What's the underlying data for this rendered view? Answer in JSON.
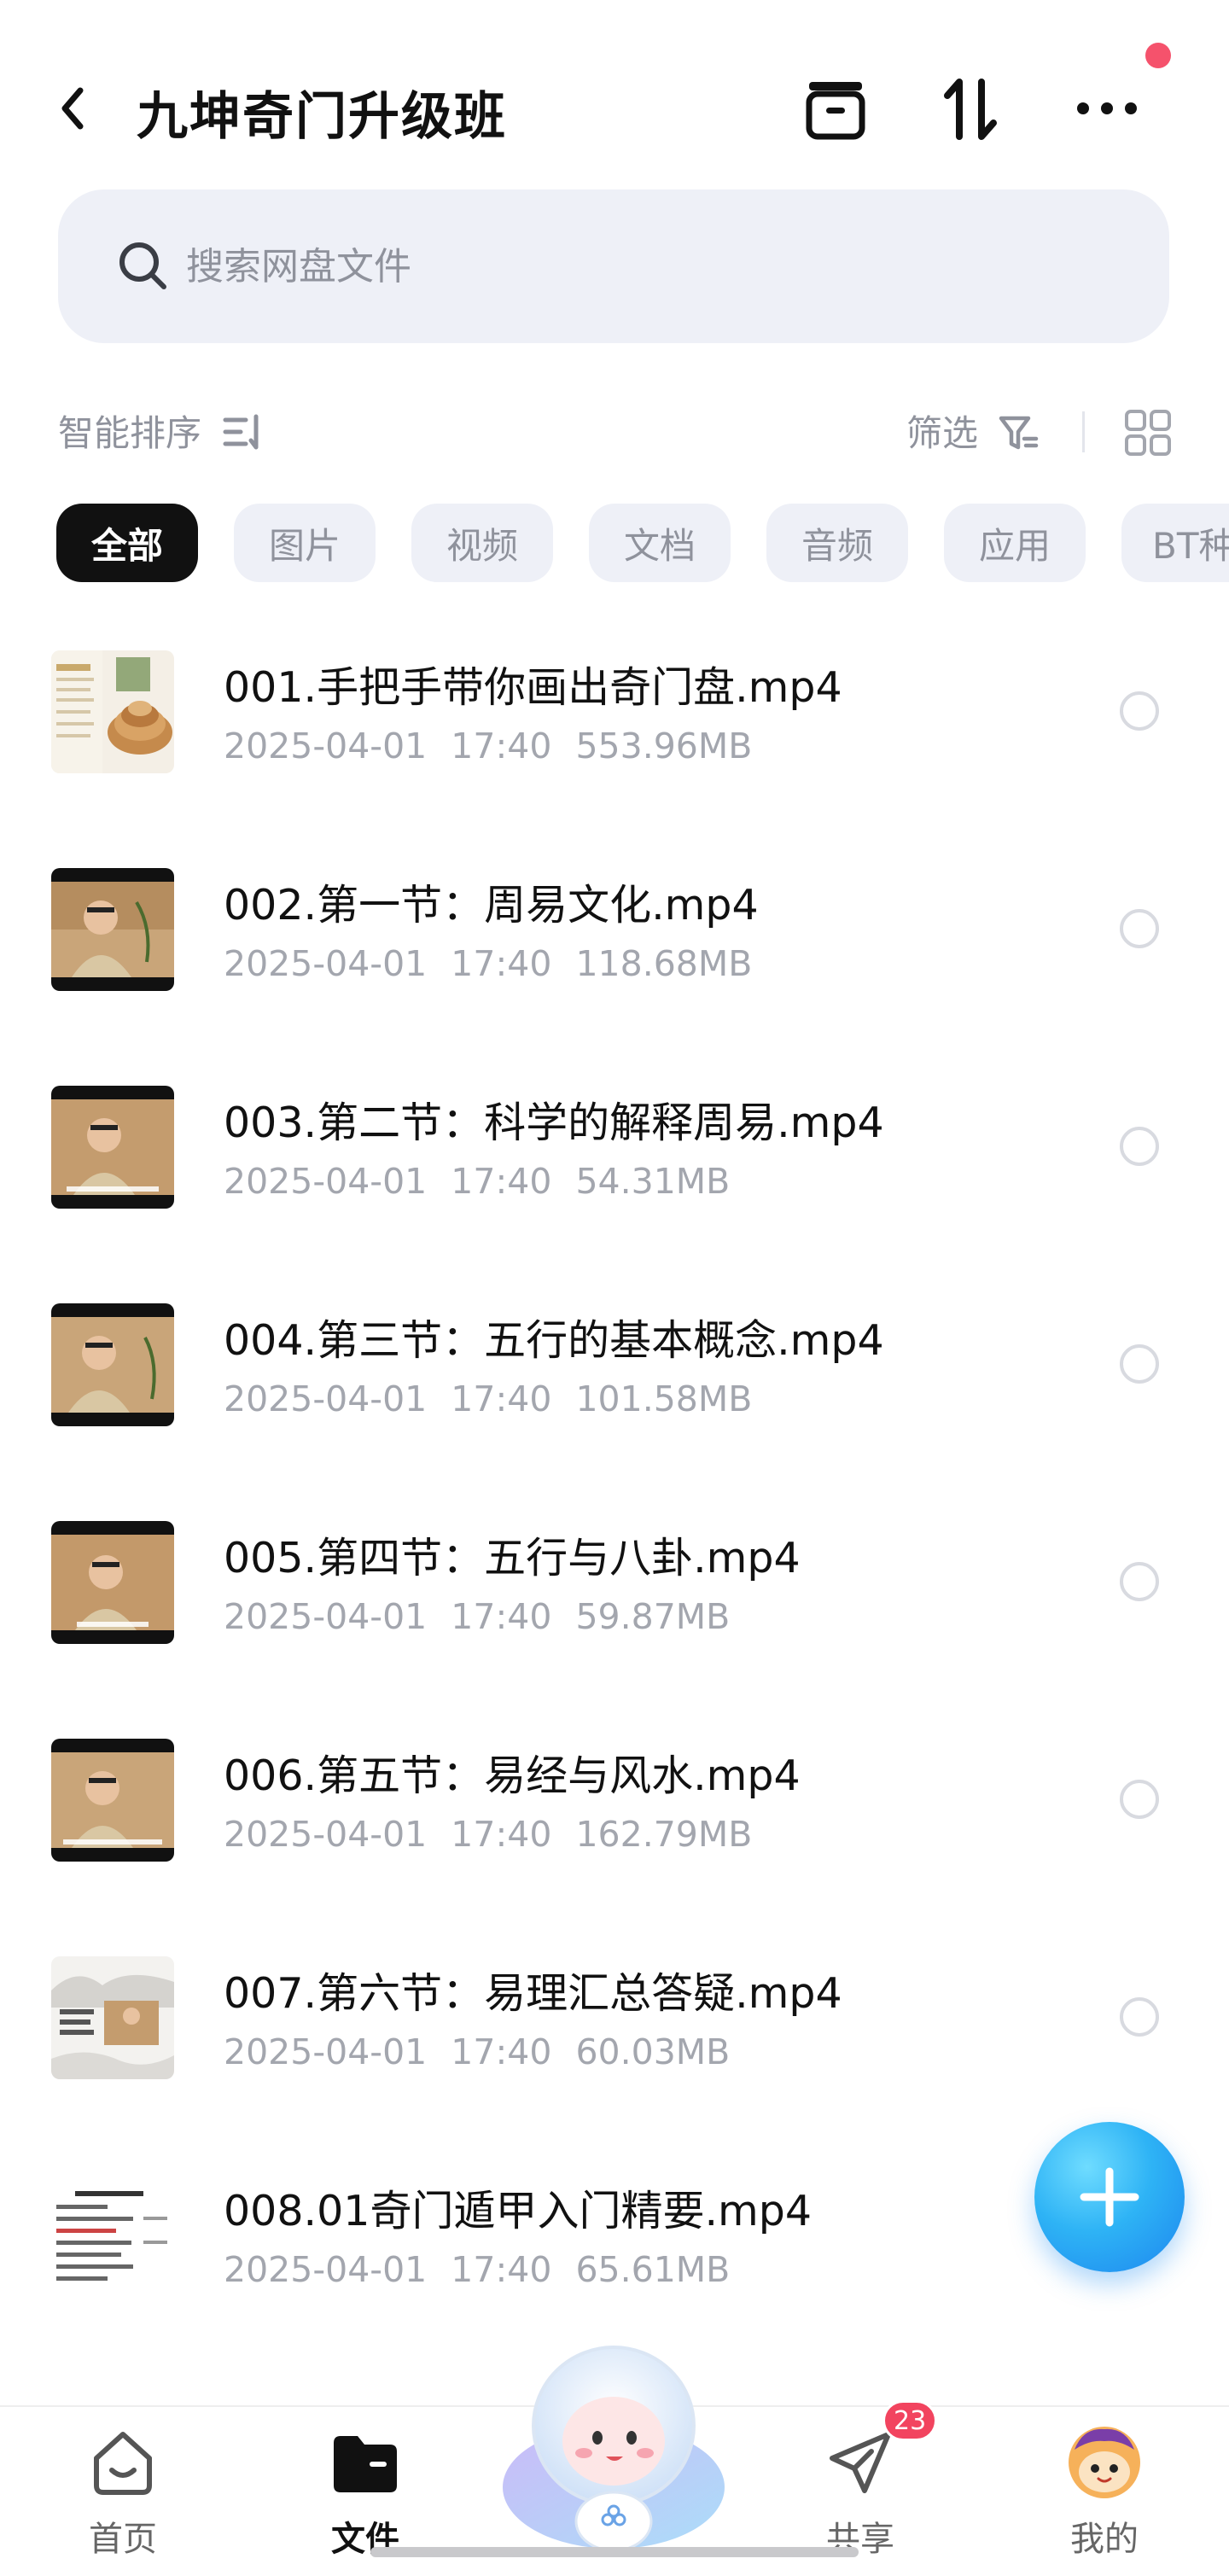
{
  "header": {
    "title": "九坤奇门升级班",
    "icons": [
      "back-icon",
      "transfer-list-icon",
      "sort-arrows-icon",
      "more-icon"
    ]
  },
  "search": {
    "placeholder": "搜索网盘文件"
  },
  "sort": {
    "label": "智能排序",
    "filter_label": "筛选"
  },
  "tabs": [
    {
      "label": "全部",
      "active": true
    },
    {
      "label": "图片"
    },
    {
      "label": "视频"
    },
    {
      "label": "文档"
    },
    {
      "label": "音频"
    },
    {
      "label": "应用"
    },
    {
      "label": "BT种"
    }
  ],
  "files": [
    {
      "name": "001.手把手带你画出奇门盘.mp4",
      "date": "2025-04-01",
      "time": "17:40",
      "size": "553.96MB"
    },
    {
      "name": "002.第一节：周易文化.mp4",
      "date": "2025-04-01",
      "time": "17:40",
      "size": "118.68MB"
    },
    {
      "name": "003.第二节：科学的解释周易.mp4",
      "date": "2025-04-01",
      "time": "17:40",
      "size": "54.31MB"
    },
    {
      "name": "004.第三节：五行的基本概念.mp4",
      "date": "2025-04-01",
      "time": "17:40",
      "size": "101.58MB"
    },
    {
      "name": "005.第四节：五行与八卦.mp4",
      "date": "2025-04-01",
      "time": "17:40",
      "size": "59.87MB"
    },
    {
      "name": "006.第五节：易经与风水.mp4",
      "date": "2025-04-01",
      "time": "17:40",
      "size": "162.79MB"
    },
    {
      "name": "007.第六节：易理汇总答疑.mp4",
      "date": "2025-04-01",
      "time": "17:40",
      "size": "60.03MB"
    },
    {
      "name": "008.01奇门遁甲入门精要.mp4",
      "date": "2025-04-01",
      "time": "17:40",
      "size": "65.61MB"
    }
  ],
  "nav": {
    "items": [
      {
        "label": "首页",
        "icon": "home-icon"
      },
      {
        "label": "文件",
        "icon": "folder-icon",
        "active": true
      },
      {
        "label": "共享",
        "icon": "paper-plane-icon",
        "badge": "23"
      },
      {
        "label": "我的",
        "icon": "avatar-icon"
      }
    ]
  },
  "colors": {
    "accent": "#111111",
    "badge": "#f2445f",
    "fab": "#2eb3f5",
    "muted_text": "#a3a6ae"
  }
}
